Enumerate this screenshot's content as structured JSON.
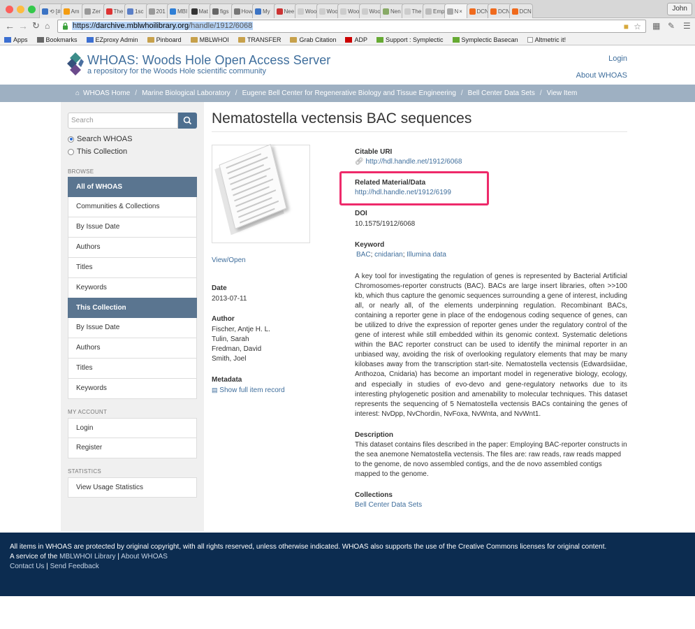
{
  "browser": {
    "tabs": [
      "⟲ [#3",
      "Am",
      "Zer",
      "The",
      "1sc",
      "201",
      "MBI",
      "Mat",
      "figs",
      "How",
      "My",
      "Nee",
      "Woo",
      "Woo",
      "Woo",
      "Woo",
      "Nen",
      "The",
      "Emp",
      "N",
      "DCN",
      "DCN",
      "DCN"
    ],
    "user_label": "John",
    "url_scheme": "https://",
    "url_host": "darchive.mblwhoilibrary.org",
    "url_path": "/handle/1912/6068",
    "bookmarks": [
      "Apps",
      "Bookmarks",
      "EZproxy Admin",
      "Pinboard",
      "MBLWHOI",
      "TRANSFER",
      "Grab Citation",
      "ADP",
      "Support : Symplectic",
      "Symplectic Basecan",
      "Altmetric it!"
    ],
    "colors": {
      "close": "#fc605c",
      "minimize": "#fdbc40",
      "zoom": "#34c84a"
    }
  },
  "header": {
    "title": "WHOAS: Woods Hole Open Access Server",
    "subtitle": "a repository for the Woods Hole scientific community",
    "login": "Login",
    "about": "About WHOAS"
  },
  "breadcrumb": [
    "WHOAS Home",
    "Marine Biological Laboratory",
    "Eugene Bell Center for Regenerative Biology and Tissue Engineering",
    "Bell Center Data Sets",
    "View Item"
  ],
  "sidebar": {
    "search_placeholder": "Search",
    "scope_all": "Search WHOAS",
    "scope_collection": "This Collection",
    "browse_heading": "BROWSE",
    "browse_all": [
      "All of WHOAS",
      "Communities & Collections",
      "By Issue Date",
      "Authors",
      "Titles",
      "Keywords"
    ],
    "browse_collection": [
      "This Collection",
      "By Issue Date",
      "Authors",
      "Titles",
      "Keywords"
    ],
    "account_heading": "MY ACCOUNT",
    "account": [
      "Login",
      "Register"
    ],
    "stats_heading": "STATISTICS",
    "stats": [
      "View Usage Statistics"
    ]
  },
  "item": {
    "title": "Nematostella vectensis BAC sequences",
    "view_open": "View/Open",
    "date_label": "Date",
    "date": "2013-07-11",
    "author_label": "Author",
    "authors": [
      "Fischer, Antje H. L.",
      "Tulin, Sarah",
      "Fredman, David",
      "Smith, Joel"
    ],
    "metadata_label": "Metadata",
    "metadata_link": "Show full item record",
    "uri_label": "Citable URI",
    "uri": "http://hdl.handle.net/1912/6068",
    "related_label": "Related Material/Data",
    "related": "http://hdl.handle.net/1912/6199",
    "doi_label": "DOI",
    "doi": "10.1575/1912/6068",
    "keyword_label": "Keyword",
    "keywords": [
      "BAC",
      "cnidarian",
      "Illumina data"
    ],
    "abstract": "A key tool for investigating the regulation of genes is represented by Bacterial Artificial Chromosomes-reporter constructs (BAC). BACs are large insert libraries, often >>100 kb, which thus capture the genomic sequences surrounding a gene of interest, including all, or nearly all, of the elements underpinning regulation. Recombinant BACs, containing a reporter gene in place of the endogenous coding sequence of genes, can be utilized to drive the expression of reporter genes under the regulatory control of the gene of interest while still embedded within its genomic context. Systematic deletions within the BAC reporter construct can be used to identify the minimal reporter in an unbiased way, avoiding the risk of overlooking regulatory elements that may be many kilobases away from the transcription start-site. Nematostella vectensis (Edwardsiidae, Anthozoa, Cnidaria) has become an important model in regenerative biology, ecology, and especially in studies of evo-devo and gene-regulatory networks due to its interesting phylogenetic position and amenability to molecular techniques. This dataset represents the sequencing of 5 Nematostella vectensis BACs containing the genes of interest: NvDpp, NvChordin, NvFoxa, NvWnta, and NvWnt1.",
    "description_label": "Description",
    "description": "This dataset contains files described in the paper: Employing BAC-reporter constructs in the sea anemone Nematostella vectensis. The files are: raw reads, raw reads mapped to the genome, de novo assembled contigs, and the de novo assembled contigs mapped to the genome.",
    "collections_label": "Collections",
    "collection": "Bell Center Data Sets"
  },
  "footer": {
    "line1": "All items in WHOAS are protected by original copyright, with all rights reserved, unless otherwise indicated. WHOAS also supports the use of the Creative Commons licenses for original content.",
    "service_prefix": "A service of the",
    "library_link": "MBLWHOI Library",
    "about_link": "About WHOAS",
    "contact_link": "Contact Us",
    "feedback_link": "Send Feedback"
  }
}
